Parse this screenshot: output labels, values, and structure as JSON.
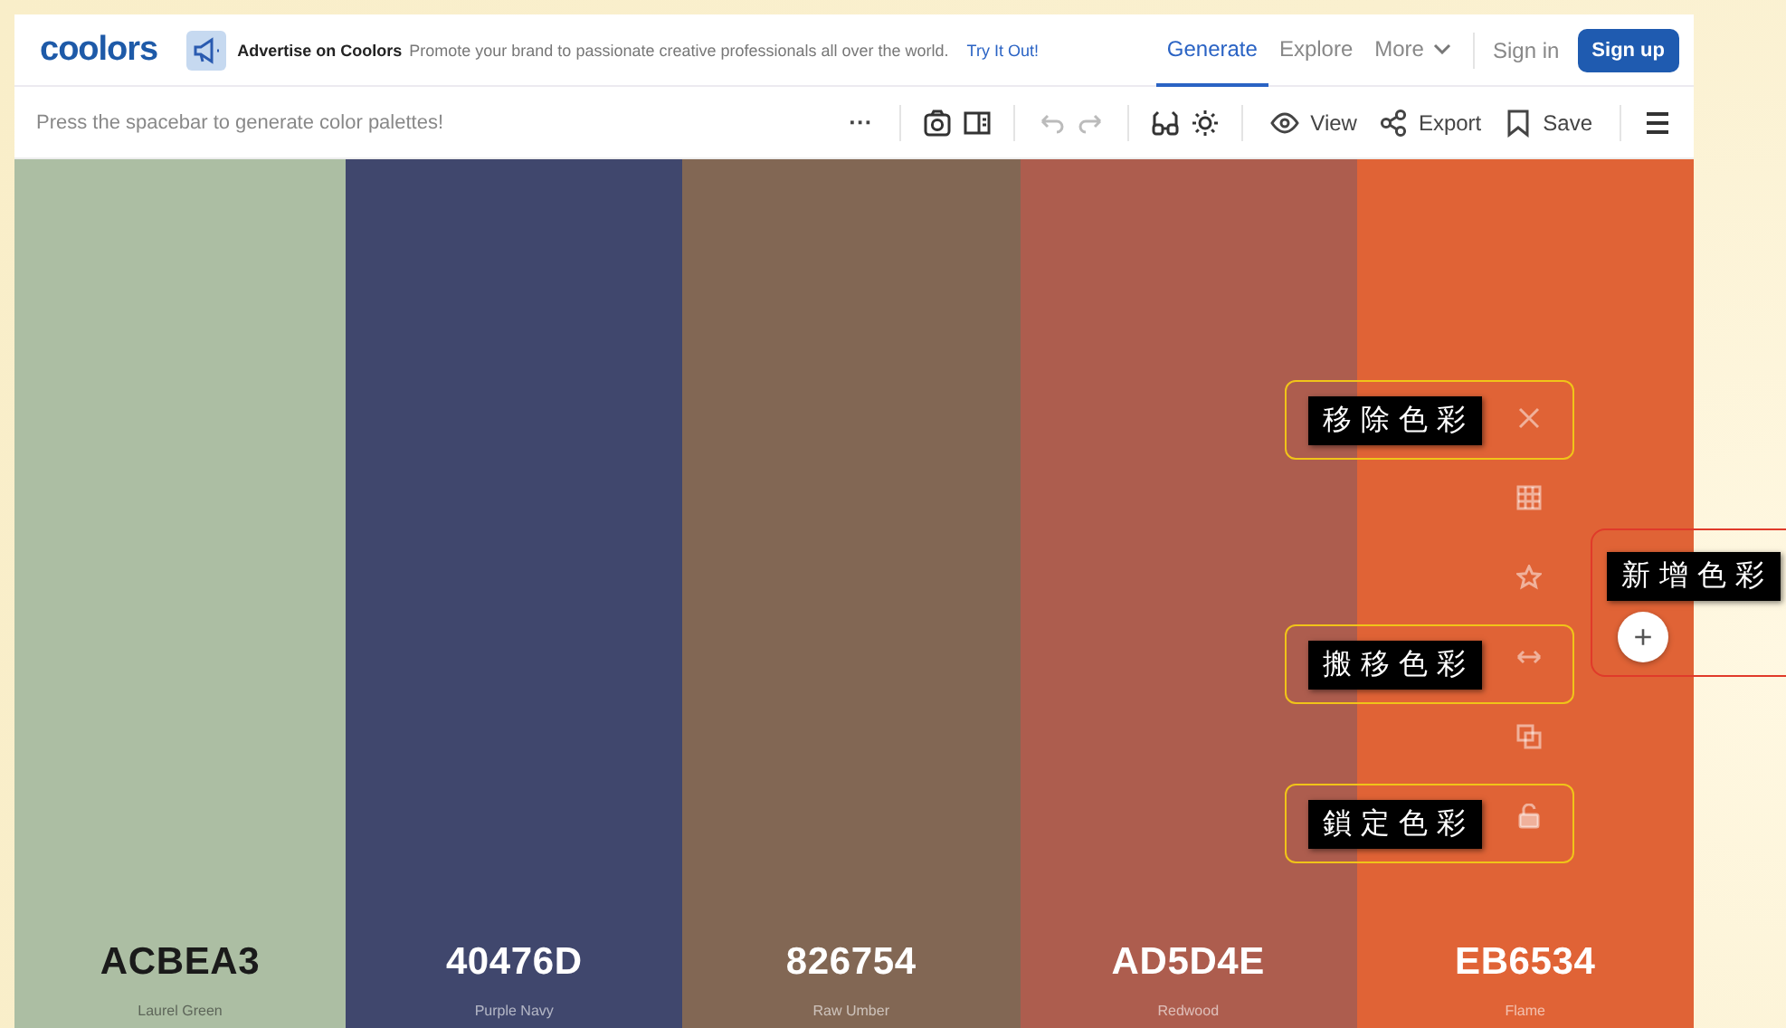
{
  "header": {
    "logo": "coolors",
    "ad": {
      "title": "Advertise on Coolors",
      "text": "Promote your brand to passionate creative professionals all over the world.",
      "link": "Try It Out!"
    },
    "nav": [
      {
        "label": "Generate",
        "selected": true
      },
      {
        "label": "Explore",
        "selected": false
      },
      {
        "label": "More",
        "selected": false
      }
    ],
    "sign_in": "Sign in",
    "sign_up": "Sign up"
  },
  "toolbar": {
    "hint": "Press the spacebar to generate color palettes!",
    "more": "···",
    "view": "View",
    "export": "Export",
    "save": "Save"
  },
  "palette": [
    {
      "hex": "ACBEA3",
      "name": "Laurel Green",
      "color": "#acbea3",
      "kind": "pale"
    },
    {
      "hex": "40476D",
      "name": "Purple Navy",
      "color": "#40476d",
      "kind": "deep"
    },
    {
      "hex": "826754",
      "name": "Raw Umber",
      "color": "#826754",
      "kind": "deep"
    },
    {
      "hex": "AD5D4E",
      "name": "Redwood",
      "color": "#ad5d4e",
      "kind": "deep"
    },
    {
      "hex": "EB6534",
      "name": "Flame",
      "color": "#e06336",
      "kind": "deep"
    }
  ],
  "annotations": [
    {
      "label": "移除色彩",
      "kind": "remove"
    },
    {
      "label": "搬移色彩",
      "kind": "move"
    },
    {
      "label": "鎖定色彩",
      "kind": "lock"
    }
  ],
  "add_annotation": {
    "label": "新增色彩",
    "button": "+"
  }
}
